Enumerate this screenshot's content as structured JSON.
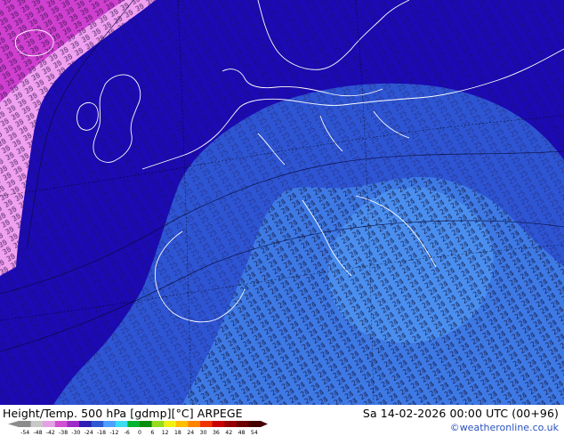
{
  "product": {
    "title": "Height/Temp. 500 hPa [gdmp][°C] ARPEGE",
    "timestamp": "Sa 14-02-2026 00:00 UTC (00+96)",
    "credit": "©weatheronline.co.uk"
  },
  "map": {
    "region": "Europe / North Atlantic",
    "contour_values_visible": [
      "21",
      "22",
      "23",
      "24",
      "25",
      "26",
      "27",
      "28",
      "29",
      "30",
      "31",
      "32"
    ],
    "colors": {
      "magenta": "#d040d0",
      "pink": "#f0a0f0",
      "deep_blue": "#1c0ab4",
      "medium_blue": "#2e55d4",
      "light_blue": "#3e7ae6",
      "lighter_blue": "#4a8ff0",
      "label_text": "#0c0c2c",
      "coastline": "#ffffff",
      "graticule": "#000000"
    }
  },
  "legend": {
    "tick_labels": [
      "-54",
      "-48",
      "-42",
      "-38",
      "-30",
      "-24",
      "-18",
      "-12",
      "-6",
      "0",
      "6",
      "12",
      "18",
      "24",
      "30",
      "36",
      "42",
      "48",
      "54"
    ],
    "colors": [
      "#8c8c8c",
      "#c8c8c8",
      "#e6a0e6",
      "#d250d2",
      "#a02ac8",
      "#2e1eb4",
      "#2d5ad2",
      "#4ca0ff",
      "#3cdcf0",
      "#00b432",
      "#0a8c0a",
      "#96dc1e",
      "#f0f014",
      "#ffbe00",
      "#ff8200",
      "#f03200",
      "#c80000",
      "#960000",
      "#6e0000",
      "#460000"
    ]
  }
}
